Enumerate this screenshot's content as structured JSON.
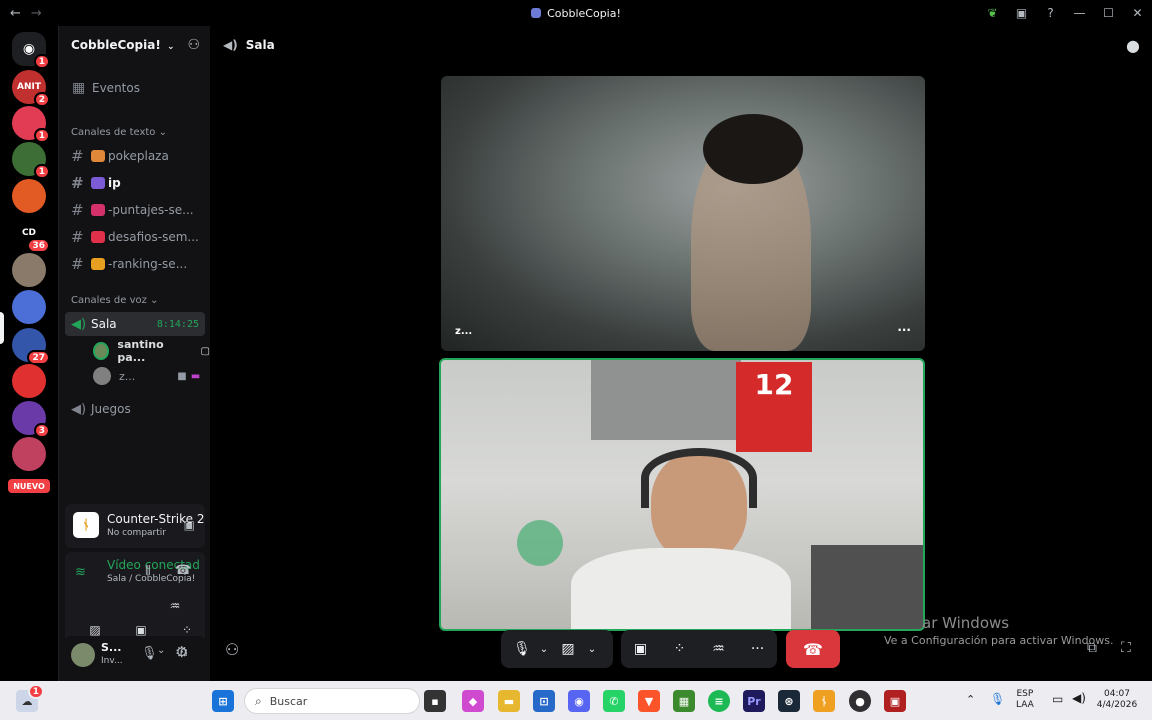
{
  "window": {
    "title": "CobbleCopia!",
    "back": "←",
    "forward": "→",
    "controls": {
      "minimize": "—",
      "maximize": "☐",
      "close": "✕"
    }
  },
  "rail": {
    "home_badge": "1",
    "servers": [
      {
        "name": "ANIT",
        "badge": "2",
        "color": "#c0302f"
      },
      {
        "name": "",
        "badge": "1",
        "color": "#e23c54"
      },
      {
        "name": "",
        "badge": "1",
        "color": "#3c6e35"
      },
      {
        "name": "",
        "badge": "",
        "color": "#e25a24"
      },
      {
        "name": "CD",
        "badge": "36",
        "color": "#000000"
      },
      {
        "name": "",
        "badge": "",
        "color": "#8a7a6a"
      },
      {
        "name": "",
        "badge": "",
        "color": "#4b6fd6"
      },
      {
        "name": "",
        "badge": "27",
        "color": "#3355aa"
      },
      {
        "name": "",
        "badge": "",
        "color": "#e03030"
      },
      {
        "name": "",
        "badge": "3",
        "color": "#6a3aa8"
      },
      {
        "name": "",
        "badge": "",
        "color": "#c04060"
      }
    ],
    "nuevo": "NUEVO"
  },
  "sidebar": {
    "server_name": "CobbleCopia!",
    "events": "Eventos",
    "text_category": "Canales de texto",
    "text_channels": [
      {
        "name": "pokeplaza",
        "emoji_color": "#e0883a"
      },
      {
        "name": "ip",
        "emoji_color": "#7b5cd6"
      },
      {
        "name": "-puntajes-se...",
        "emoji_color": "#d4306a"
      },
      {
        "name": "desafios-sem...",
        "emoji_color": "#e0304a"
      },
      {
        "name": "-ranking-se...",
        "emoji_color": "#e8a020"
      }
    ],
    "voice_category": "Canales de voz",
    "voice_channel": {
      "name": "Sala",
      "time": "8:14:25"
    },
    "voice_users": [
      {
        "name": "santino pa..."
      },
      {
        "name": "z..."
      }
    ],
    "voice_channel_2": "Juegos"
  },
  "activity": {
    "game": "Counter-Strike 2",
    "sub": "No compartir"
  },
  "connection": {
    "status": "Vídeo conectad",
    "location": "Sala / CobbleCopia!"
  },
  "user_panel": {
    "name": "S...",
    "status": "Inv..."
  },
  "main": {
    "channel": "Sala",
    "tile1_name": "z...",
    "tile_menu": "···"
  },
  "watermark": {
    "line1": "ar Windows",
    "line2": "Ve a Configuración para activar Windows."
  },
  "taskbar": {
    "search_placeholder": "Buscar",
    "notif_badge": "1",
    "lang1": "ESP",
    "lang2": "LAA",
    "time": "04:07",
    "date": "4/4/2026"
  },
  "colors": {
    "accent_green": "#23a55a",
    "danger": "#da373c",
    "sidebar_bg": "#121214"
  }
}
